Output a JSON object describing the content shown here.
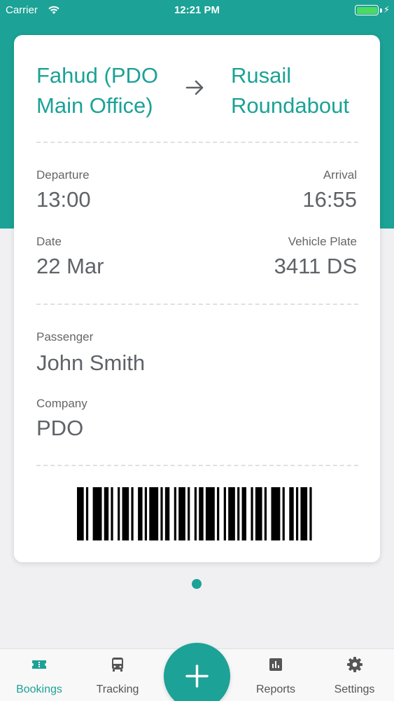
{
  "status_bar": {
    "carrier": "Carrier",
    "time": "12:21 PM",
    "battery_level": 1.0,
    "icons": [
      "wifi-icon",
      "battery-icon",
      "charging-bolt-icon"
    ]
  },
  "ticket": {
    "from": "Fahud (PDO Main Office)",
    "to": "Rusail Roundabout",
    "departure_label": "Departure",
    "departure_value": "13:00",
    "arrival_label": "Arrival",
    "arrival_value": "16:55",
    "date_label": "Date",
    "date_value": "22 Mar",
    "plate_label": "Vehicle Plate",
    "plate_value": "3411 DS",
    "passenger_label": "Passenger",
    "passenger_value": "John Smith",
    "company_label": "Company",
    "company_value": "PDO"
  },
  "pager": {
    "current_page": 1,
    "total_pages": 1
  },
  "tabbar": {
    "bookings": "Bookings",
    "tracking": "Tracking",
    "reports": "Reports",
    "settings": "Settings",
    "active": "bookings"
  },
  "colors": {
    "accent": "#1ca296",
    "card_background": "#ffffff",
    "page_background": "#f0f0f2",
    "battery_green": "#4cd964"
  }
}
